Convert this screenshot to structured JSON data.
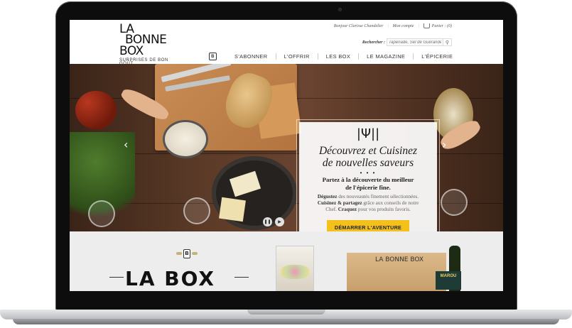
{
  "header": {
    "logo": {
      "line1": "LA",
      "line2": "BONNE",
      "line3": "BOX",
      "tagline": "SURPRISES DE BON GOÛT"
    },
    "greeting": "Bonjour Clarisse Chandelier",
    "account_link": "Mon compte",
    "cart_label": "Panier : (0)",
    "search": {
      "label": "Rechercher :",
      "placeholder": "Tapenade, Sel de Guérande..."
    },
    "nav": {
      "home_icon": "B",
      "items": [
        "S'ABONNER",
        "L'OFFRIR",
        "LES BOX",
        "LE MAGAZINE",
        "L'ÉPICERIE"
      ]
    }
  },
  "hero": {
    "title_line1": "Découvrez et Cuisinez",
    "title_line2": "de nouvelles saveurs",
    "bullets": "• • •",
    "lead_line1": "Partez à la découverte du meilleur",
    "lead_line2": "de l'épicerie fine.",
    "body": {
      "p1_bold": "Dégustez",
      "p1_rest": " des nouveautés finement sélectionnées. ",
      "p2_bold": "Cuisinez & partagez",
      "p2_rest": " grâce aux conseils de notre Chef. ",
      "p3_bold": "Craquez",
      "p3_rest": " pour vos produits favoris."
    },
    "cta": "DÉMARRER L'AVENTURE",
    "slides_total": 4,
    "slide_active": 1
  },
  "lower": {
    "badge": "B",
    "title": "LA BOX",
    "box_logo": "LA BONNE BOX",
    "marou_label": "MAROU"
  },
  "icons": {
    "cart": "basket-icon",
    "search": "magnifier-icon",
    "home": "b-logo-icon",
    "prev": "chevron-left-icon",
    "next": "chevron-right-icon",
    "pause": "pause-icon",
    "play": "play-icon",
    "cutlery": "cutlery-icon"
  },
  "colors": {
    "cta": "#f4c01b",
    "hero_wood": "#5b3a27",
    "lower_bg": "#ededed"
  }
}
